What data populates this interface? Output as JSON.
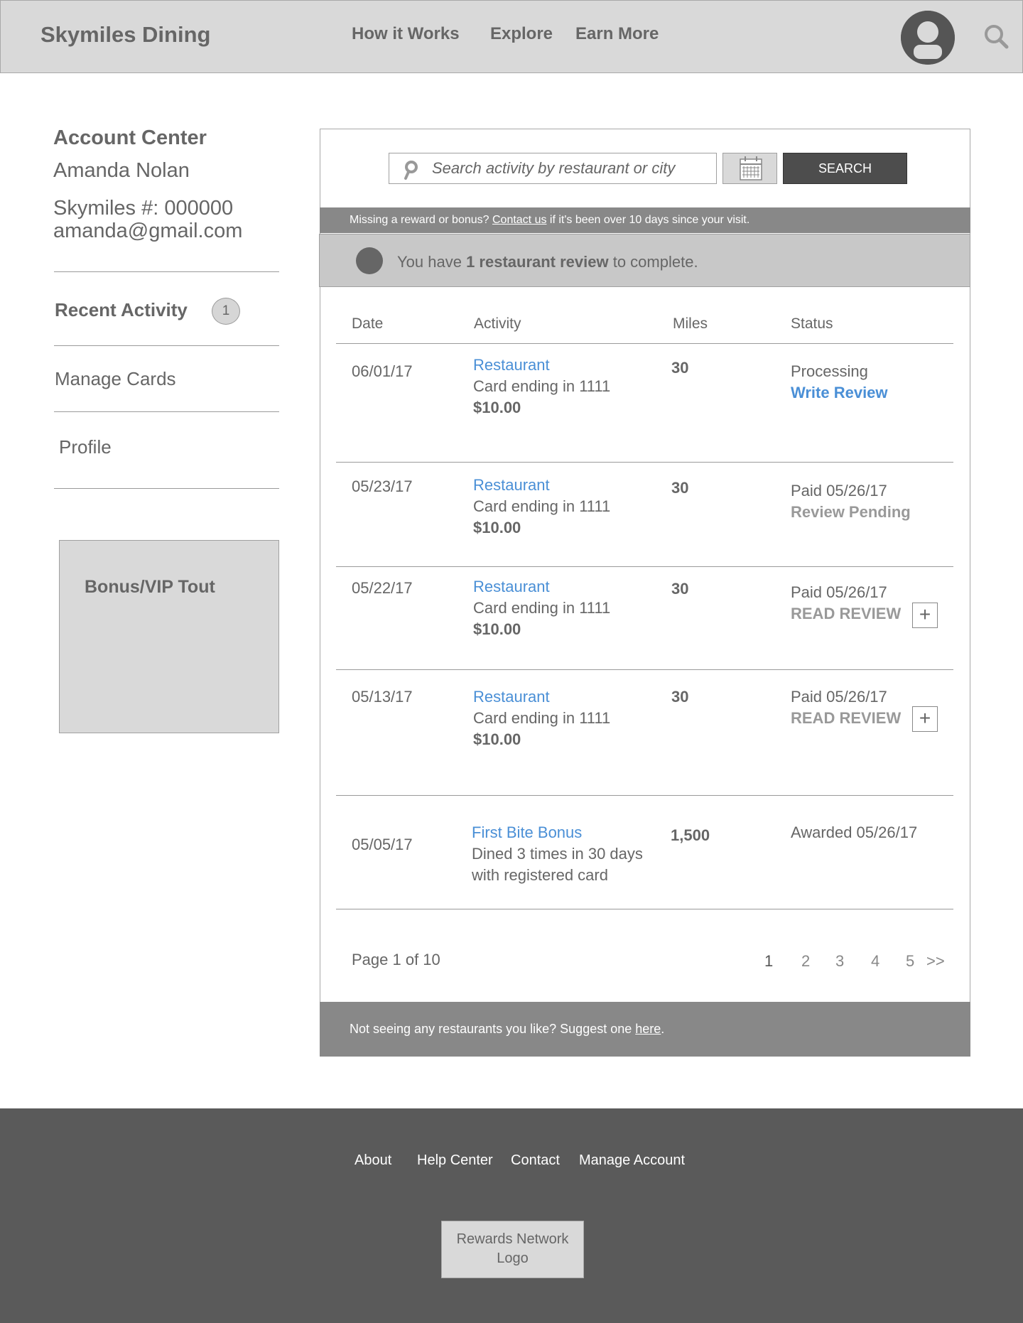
{
  "header": {
    "brand": "Skymiles Dining",
    "nav": [
      "How it Works",
      "Explore",
      "Earn More"
    ],
    "avatar_icon": "user-avatar-icon",
    "search_icon": "search-icon"
  },
  "sidebar": {
    "title": "Account Center",
    "name": "Amanda Nolan",
    "skymiles_number": "Skymiles #: 000000",
    "email": "amanda@gmail.com",
    "items": [
      {
        "label": "Recent Activity",
        "badge": "1",
        "active": true
      },
      {
        "label": "Manage Cards"
      },
      {
        "label": "Profile"
      }
    ],
    "tout_label": "Bonus/VIP Tout"
  },
  "search": {
    "placeholder": "Search activity by restaurant or city",
    "button_label": "SEARCH",
    "calendar_icon": "calendar-icon"
  },
  "notice": {
    "before": "Missing a reward or bonus? ",
    "link": "Contact us",
    "after": " if it's been over 10 days since your visit."
  },
  "review_banner": {
    "before": "You have ",
    "bold": "1 restaurant review",
    "after": " to complete."
  },
  "table": {
    "columns": [
      "Date",
      "Activity",
      "Miles",
      "Status"
    ],
    "rows": [
      {
        "date": "06/01/17",
        "activity_link": "Restaurant",
        "detail": "Card ending in 1111",
        "amount": "$10.00",
        "miles": "30",
        "status": "Processing",
        "action": "Write Review"
      },
      {
        "date": "05/23/17",
        "activity_link": "Restaurant",
        "detail": "Card ending in 1111",
        "amount": "$10.00",
        "miles": "30",
        "status": "Paid 05/26/17",
        "action": "Review Pending"
      },
      {
        "date": "05/22/17",
        "activity_link": "Restaurant",
        "detail": "Card ending in 1111",
        "amount": "$10.00",
        "miles": "30",
        "status": "Paid 05/26/17",
        "action": "READ REVIEW",
        "expand": "+"
      },
      {
        "date": "05/13/17",
        "activity_link": "Restaurant",
        "detail": "Card ending in 1111",
        "amount": "$10.00",
        "miles": "30",
        "status": "Paid 05/26/17",
        "action": "READ REVIEW",
        "expand": "+"
      },
      {
        "date": "05/05/17",
        "activity_link": "First Bite Bonus",
        "detail": "Dined 3 times in 30 days",
        "detail2": "with registered card",
        "miles": "1,500",
        "status": "Awarded 05/26/17"
      }
    ]
  },
  "pagination": {
    "info": "Page 1 of 10",
    "pages": [
      "1",
      "2",
      "3",
      "4",
      "5"
    ],
    "next": ">>"
  },
  "suggest": {
    "before": "Not seeing any restaurants you like?  Suggest one ",
    "link": "here",
    "after": "."
  },
  "footer": {
    "links": [
      "About",
      "Help Center",
      "Contact",
      "Manage Account"
    ],
    "logo_line1": "Rewards Network",
    "logo_line2": "Logo"
  }
}
